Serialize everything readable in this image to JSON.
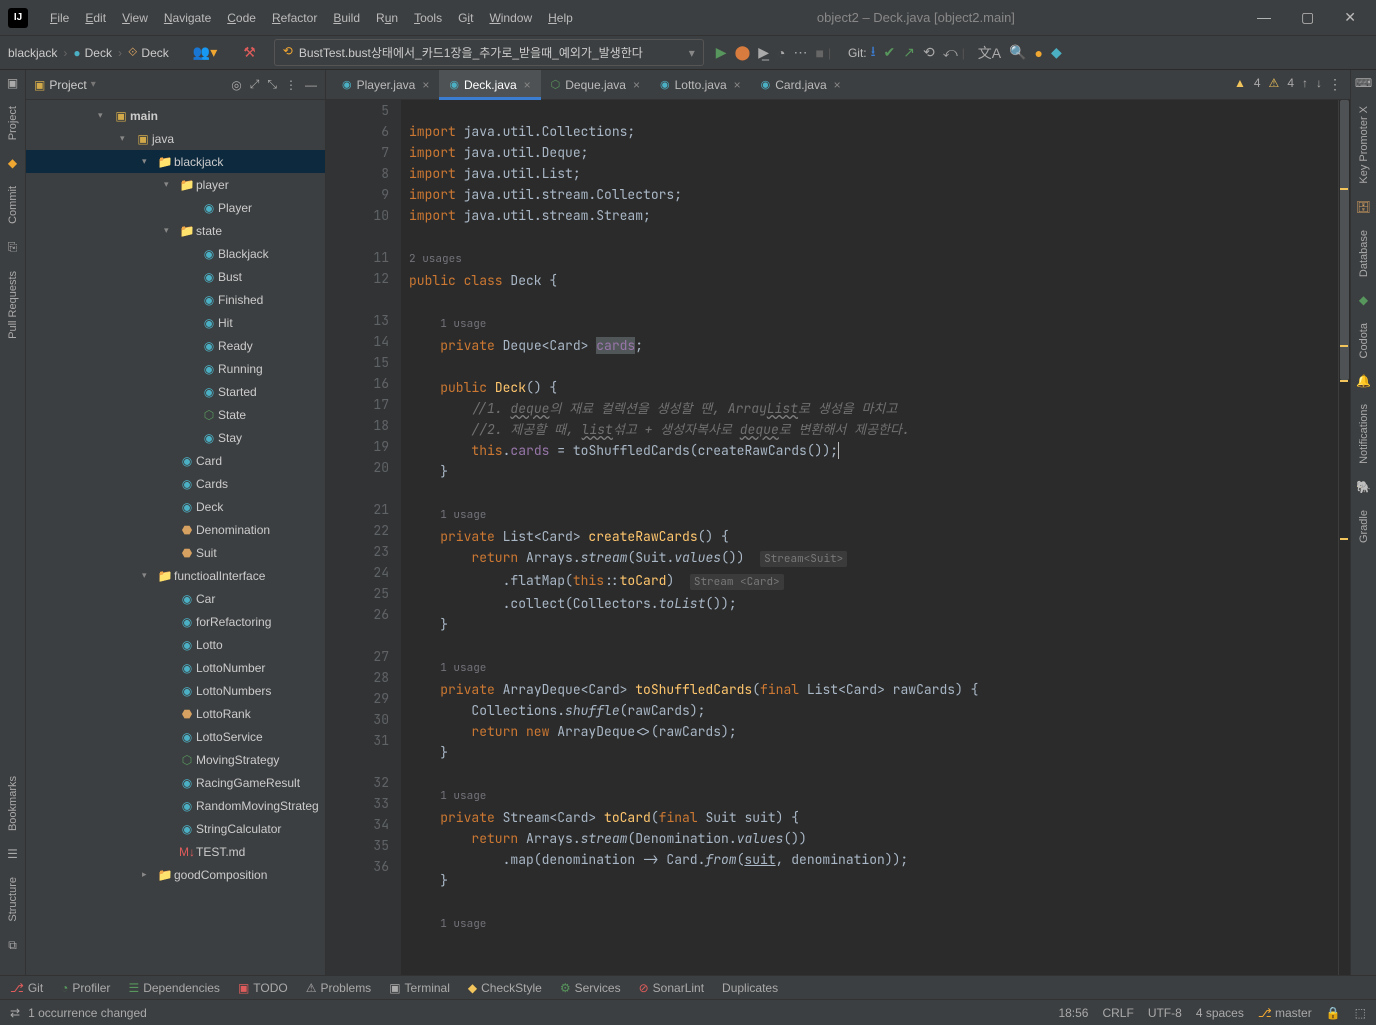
{
  "window": {
    "title": "object2 – Deck.java [object2.main]"
  },
  "menu": {
    "file": "File",
    "edit": "Edit",
    "view": "View",
    "navigate": "Navigate",
    "code": "Code",
    "refactor": "Refactor",
    "build": "Build",
    "run": "Run",
    "tools": "Tools",
    "git": "Git",
    "window": "Window",
    "help": "Help"
  },
  "crumb": {
    "a": "blackjack",
    "b": "Deck",
    "c": "Deck"
  },
  "runconfig": {
    "label": "BustTest.bust상태에서_카드1장을_추가로_받을때_예외가_발생한다"
  },
  "git_label": "Git:",
  "panel": {
    "title": "Project"
  },
  "tree": {
    "main": "main",
    "java": "java",
    "blackjack": "blackjack",
    "player_pkg": "player",
    "Player": "Player",
    "state_pkg": "state",
    "Blackjack": "Blackjack",
    "Bust": "Bust",
    "Finished": "Finished",
    "Hit": "Hit",
    "Ready": "Ready",
    "Running": "Running",
    "Started": "Started",
    "State": "State",
    "Stay": "Stay",
    "Card": "Card",
    "Cards": "Cards",
    "Deck": "Deck",
    "Denomination": "Denomination",
    "Suit": "Suit",
    "functioal": "functioalInterface",
    "Car": "Car",
    "forRefactoring": "forRefactoring",
    "Lotto": "Lotto",
    "LottoNumber": "LottoNumber",
    "LottoNumbers": "LottoNumbers",
    "LottoRank": "LottoRank",
    "LottoService": "LottoService",
    "MovingStrategy": "MovingStrategy",
    "RacingGameResult": "RacingGameResult",
    "RandomMovingStrategy": "RandomMovingStrateg",
    "StringCalculator": "StringCalculator",
    "TEST": "TEST.md",
    "goodComposition": "goodComposition"
  },
  "tabs": {
    "player": "Player.java",
    "deck": "Deck.java",
    "deque": "Deque.java",
    "lotto": "Lotto.java",
    "card": "Card.java"
  },
  "indicators": {
    "warn_count": "4",
    "insp_count": "4"
  },
  "gutter": [
    "5",
    "6",
    "7",
    "8",
    "9",
    "10",
    "",
    "11",
    "12",
    "",
    "13",
    "14",
    "15",
    "16",
    "17",
    "18",
    "19",
    "20",
    "",
    "21",
    "22",
    "23",
    "24",
    "25",
    "26",
    "",
    "27",
    "28",
    "29",
    "30",
    "31",
    "",
    "32",
    "33",
    "34",
    "35",
    "36",
    ""
  ],
  "usages": {
    "two": "2 usages",
    "one": "1 usage"
  },
  "code": {
    "l5": "import java.util.Collections;",
    "l6": "import java.util.Deque;",
    "l7": "import java.util.List;",
    "l8": "import java.util.stream.Collectors;",
    "l9": "import java.util.stream.Stream;",
    "l11": "public class Deck {",
    "l13": "    private Deque<Card> cards;",
    "l15": "    public Deck() {",
    "l16": "        //1. deque의 재료 컬렉션을 생성할 땐, ArrayList로 생성을 마치고",
    "l17": "        //2. 제공할 때, list섞고 + 생성자복사로 deque로 변환해서 제공한다.",
    "l18": "        this.cards = toShuffledCards(createRawCards());",
    "l19": "    }",
    "l21": "    private List<Card> createRawCards() {",
    "l22": "        return Arrays.stream(Suit.values())  Stream<Suit>",
    "l23": "            .flatMap(this::toCard)  Stream <Card>",
    "l24": "            .collect(Collectors.toList());",
    "l25": "    }",
    "l27": "    private ArrayDeque<Card> toShuffledCards(final List<Card> rawCards) {",
    "l28": "        Collections.shuffle(rawCards);",
    "l29": "        return new ArrayDeque<>(rawCards);",
    "l30": "    }",
    "l32": "    private Stream<Card> toCard(final Suit suit) {",
    "l33": "        return Arrays.stream(Denomination.values())",
    "l34": "            .map(denomination -> Card.from(suit, denomination));",
    "l35": "    }"
  },
  "bottom": {
    "git": "Git",
    "profiler": "Profiler",
    "deps": "Dependencies",
    "todo": "TODO",
    "problems": "Problems",
    "terminal": "Terminal",
    "checkstyle": "CheckStyle",
    "services": "Services",
    "sonar": "SonarLint",
    "dup": "Duplicates"
  },
  "status": {
    "msg": "1 occurrence changed",
    "time": "18:56",
    "eol": "CRLF",
    "enc": "UTF-8",
    "indent": "4 spaces",
    "branch": "master"
  },
  "rails": {
    "project": "Project",
    "commit": "Commit",
    "pull": "Pull Requests",
    "bookmarks": "Bookmarks",
    "structure": "Structure",
    "keypromoter": "Key Promoter X",
    "database": "Database",
    "codota": "Codota",
    "notifications": "Notifications",
    "gradle": "Gradle"
  }
}
